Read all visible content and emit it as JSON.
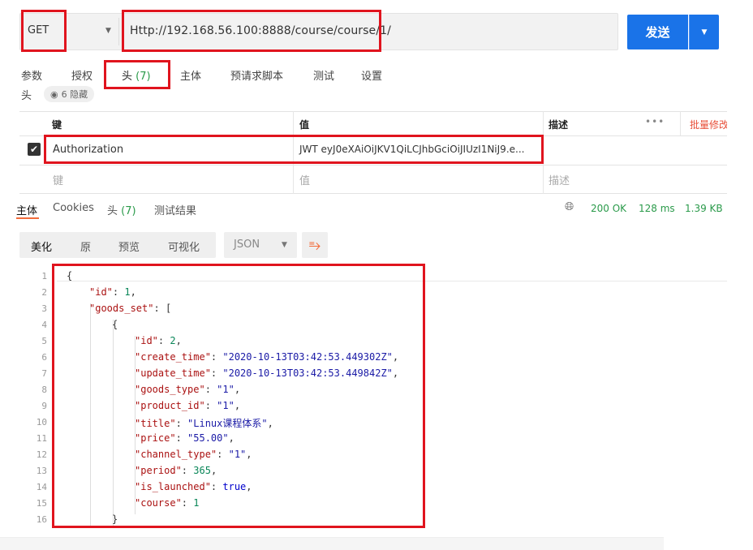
{
  "request": {
    "method": "GET",
    "url": "Http://192.168.56.100:8888/course/course/1/",
    "send_label": "发送"
  },
  "request_tabs": [
    {
      "label": "参数"
    },
    {
      "label": "授权"
    },
    {
      "label": "头",
      "count": "(7)"
    },
    {
      "label": "主体"
    },
    {
      "label": "预请求脚本"
    },
    {
      "label": "测试"
    },
    {
      "label": "设置"
    }
  ],
  "headers_section": {
    "title": "头",
    "hidden_label": "6 隐藏"
  },
  "headers_table": {
    "columns": {
      "key": "键",
      "value": "值",
      "description": "描述",
      "more": "•••",
      "bulk_edit": "批量修改"
    },
    "rows": [
      {
        "checked": true,
        "key": "Authorization",
        "value": "JWT eyJ0eXAiOiJKV1QiLCJhbGciOiJIUzI1NiJ9.e..."
      }
    ],
    "placeholder": {
      "key": "键",
      "value": "值",
      "description": "描述"
    }
  },
  "response_tabs": [
    {
      "label": "主体",
      "active": true
    },
    {
      "label": "Cookies"
    },
    {
      "label": "头",
      "count": "(7)"
    },
    {
      "label": "测试结果"
    }
  ],
  "response_status": {
    "status": "200 OK",
    "time": "128 ms",
    "size": "1.39 KB"
  },
  "view_buttons": [
    "美化",
    "原",
    "预览",
    "可视化"
  ],
  "format_select": "JSON",
  "code_lines": [
    {
      "n": "1"
    },
    {
      "n": "2"
    },
    {
      "n": "3"
    },
    {
      "n": "4"
    },
    {
      "n": "5"
    },
    {
      "n": "6"
    },
    {
      "n": "7"
    },
    {
      "n": "8"
    },
    {
      "n": "9"
    },
    {
      "n": "10"
    },
    {
      "n": "11"
    },
    {
      "n": "12"
    },
    {
      "n": "13"
    },
    {
      "n": "14"
    },
    {
      "n": "15"
    },
    {
      "n": "16"
    }
  ],
  "json_body": {
    "l1": "{",
    "l2": {
      "key": "\"id\"",
      "val": "1"
    },
    "l3": {
      "key": "\"goods_set\"",
      "tail": "["
    },
    "l4": "{",
    "l5": {
      "key": "\"id\"",
      "val": "2"
    },
    "l6": {
      "key": "\"create_time\"",
      "val": "\"2020-10-13T03:42:53.449302Z\""
    },
    "l7": {
      "key": "\"update_time\"",
      "val": "\"2020-10-13T03:42:53.449842Z\""
    },
    "l8": {
      "key": "\"goods_type\"",
      "val": "\"1\""
    },
    "l9": {
      "key": "\"product_id\"",
      "val": "\"1\""
    },
    "l10": {
      "key": "\"title\"",
      "val": "\"Linux课程体系\""
    },
    "l11": {
      "key": "\"price\"",
      "val": "\"55.00\""
    },
    "l12": {
      "key": "\"channel_type\"",
      "val": "\"1\""
    },
    "l13": {
      "key": "\"period\"",
      "val": "365"
    },
    "l14": {
      "key": "\"is_launched\"",
      "val": "true"
    },
    "l15": {
      "key": "\"course\"",
      "val": "1"
    },
    "l16": "}"
  },
  "colors": {
    "accent": "#1a73e8",
    "highlight": "#e0141e",
    "success": "#2a9a4a",
    "tab_indicator": "#f26b3a"
  }
}
